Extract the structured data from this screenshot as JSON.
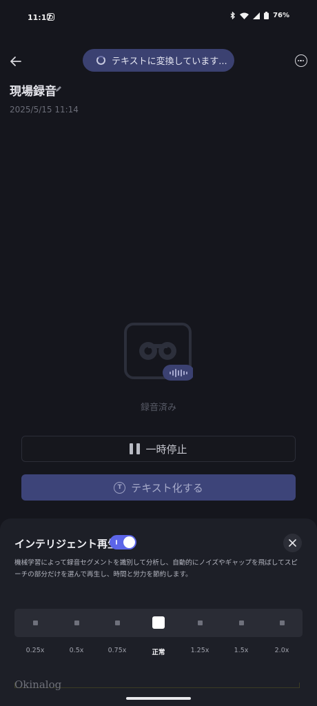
{
  "status_bar": {
    "time": "11:17",
    "battery": "76%"
  },
  "toast": {
    "text": "テキストに変換しています..."
  },
  "recording": {
    "title": "現場録音",
    "date": "2025/5/15 11:14",
    "status_label": "録音済み"
  },
  "controls": {
    "pause_label": "一時停止",
    "transcribe_label": "テキスト化する",
    "transcribe_icon_letter": "T"
  },
  "smart_play": {
    "title": "インテリジェント再生",
    "enabled": true,
    "description": "機械学習によって録音セグメントを識別して分析し、自動的にノイズやギャップを飛ばしてスピーチの部分だけを選んで再生し、時間と労力を節約します。",
    "speeds": [
      "0.25x",
      "0.5x",
      "0.75x",
      "正常",
      "1.25x",
      "1.5x",
      "2.0x"
    ],
    "selected_speed": "正常"
  },
  "watermark": "Okinalog",
  "colors": {
    "background": "#15161d",
    "accent": "#5c65e8",
    "button_primary": "#3d4479",
    "toast": "#3b4171"
  }
}
